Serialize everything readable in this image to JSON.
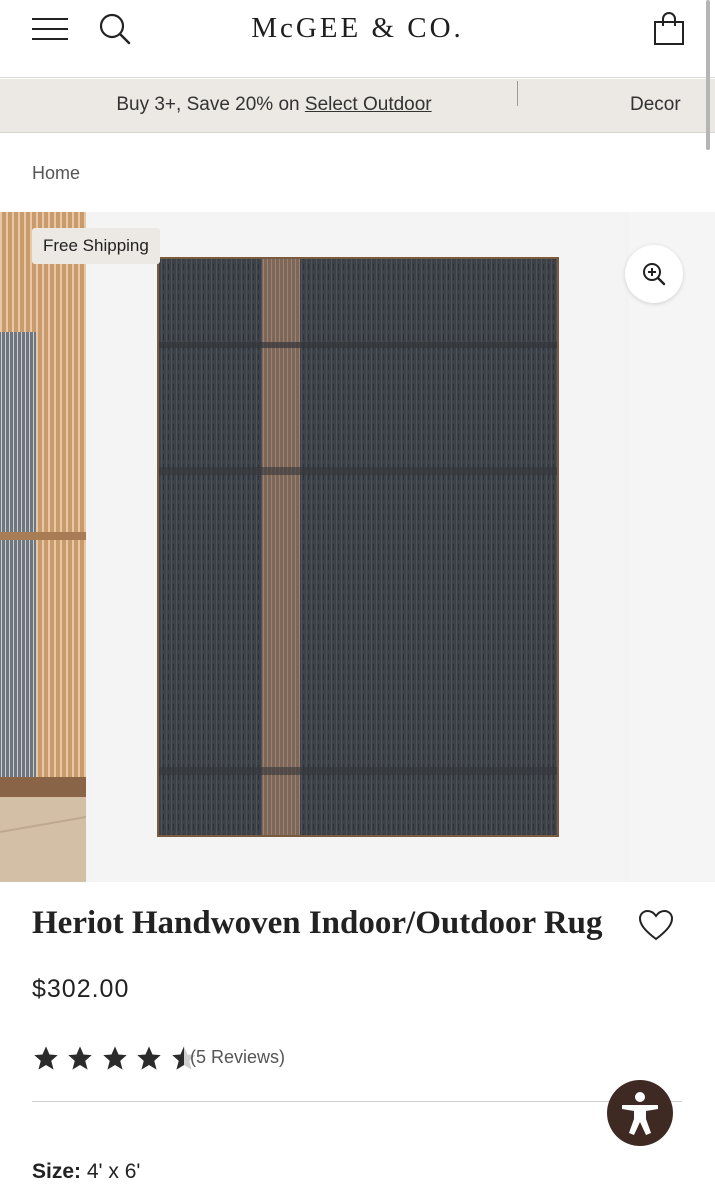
{
  "header": {
    "logo_text": "McGEE & CO."
  },
  "promo": {
    "text_prefix": "Buy 3+, Save 20% on ",
    "link_text": "Select Outdoor",
    "text2": "Decor"
  },
  "breadcrumb": {
    "home": "Home"
  },
  "gallery": {
    "badge": "Free Shipping"
  },
  "product": {
    "title": "Heriot Handwoven Indoor/Outdoor Rug",
    "price": "$302.00",
    "rating": 4.5,
    "reviews_label": "(5 Reviews)",
    "size_label": "Size:",
    "size_value": "4' x 6'"
  },
  "colors": {
    "promo_bg": "#ece8e3",
    "rug_dark": "#3c4046",
    "rug_stripe": "#8a7362",
    "a11y_bg": "#3e2a23"
  }
}
